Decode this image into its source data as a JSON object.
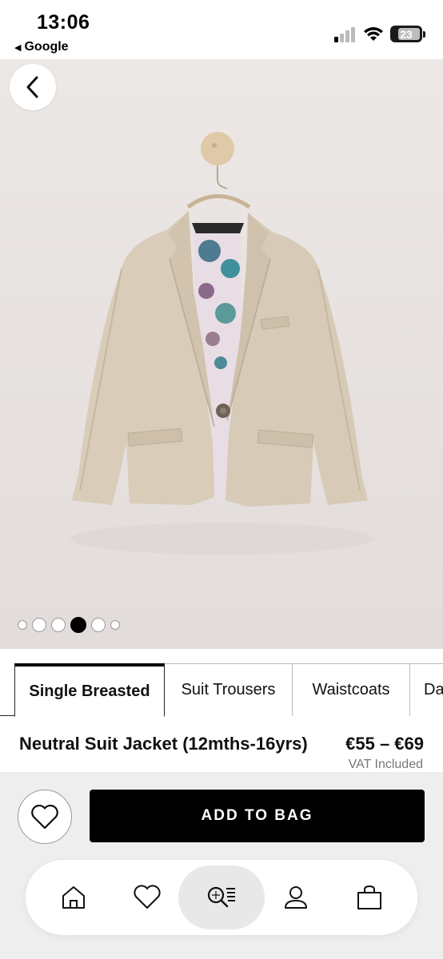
{
  "status_bar": {
    "time": "13:06",
    "back_app": "Google",
    "battery": "23"
  },
  "gallery": {
    "back_icon": "chevron-left-icon",
    "image_alt": "beige suit jacket on wooden hanger",
    "dot_count": 6,
    "active_dot": 4
  },
  "tabs": [
    {
      "label": "Single Breasted",
      "active": true
    },
    {
      "label": "Suit Trousers",
      "active": false
    },
    {
      "label": "Waistcoats",
      "active": false
    },
    {
      "label": "Da",
      "active": false
    }
  ],
  "product": {
    "name": "Neutral Suit Jacket (12mths-16yrs)",
    "price": "€55 – €69",
    "vat": "VAT Included"
  },
  "actions": {
    "wishlist_icon": "heart-outline-icon",
    "add_to_bag": "ADD TO BAG"
  },
  "bottom_nav": [
    {
      "icon": "home-icon",
      "active": false
    },
    {
      "icon": "heart-icon",
      "active": false
    },
    {
      "icon": "search-list-icon",
      "active": true
    },
    {
      "icon": "account-icon",
      "active": false
    },
    {
      "icon": "bag-icon",
      "active": false
    }
  ],
  "colors": {
    "background": "#e6e1df",
    "jacket": "#d9ccb8",
    "button": "#000000"
  }
}
